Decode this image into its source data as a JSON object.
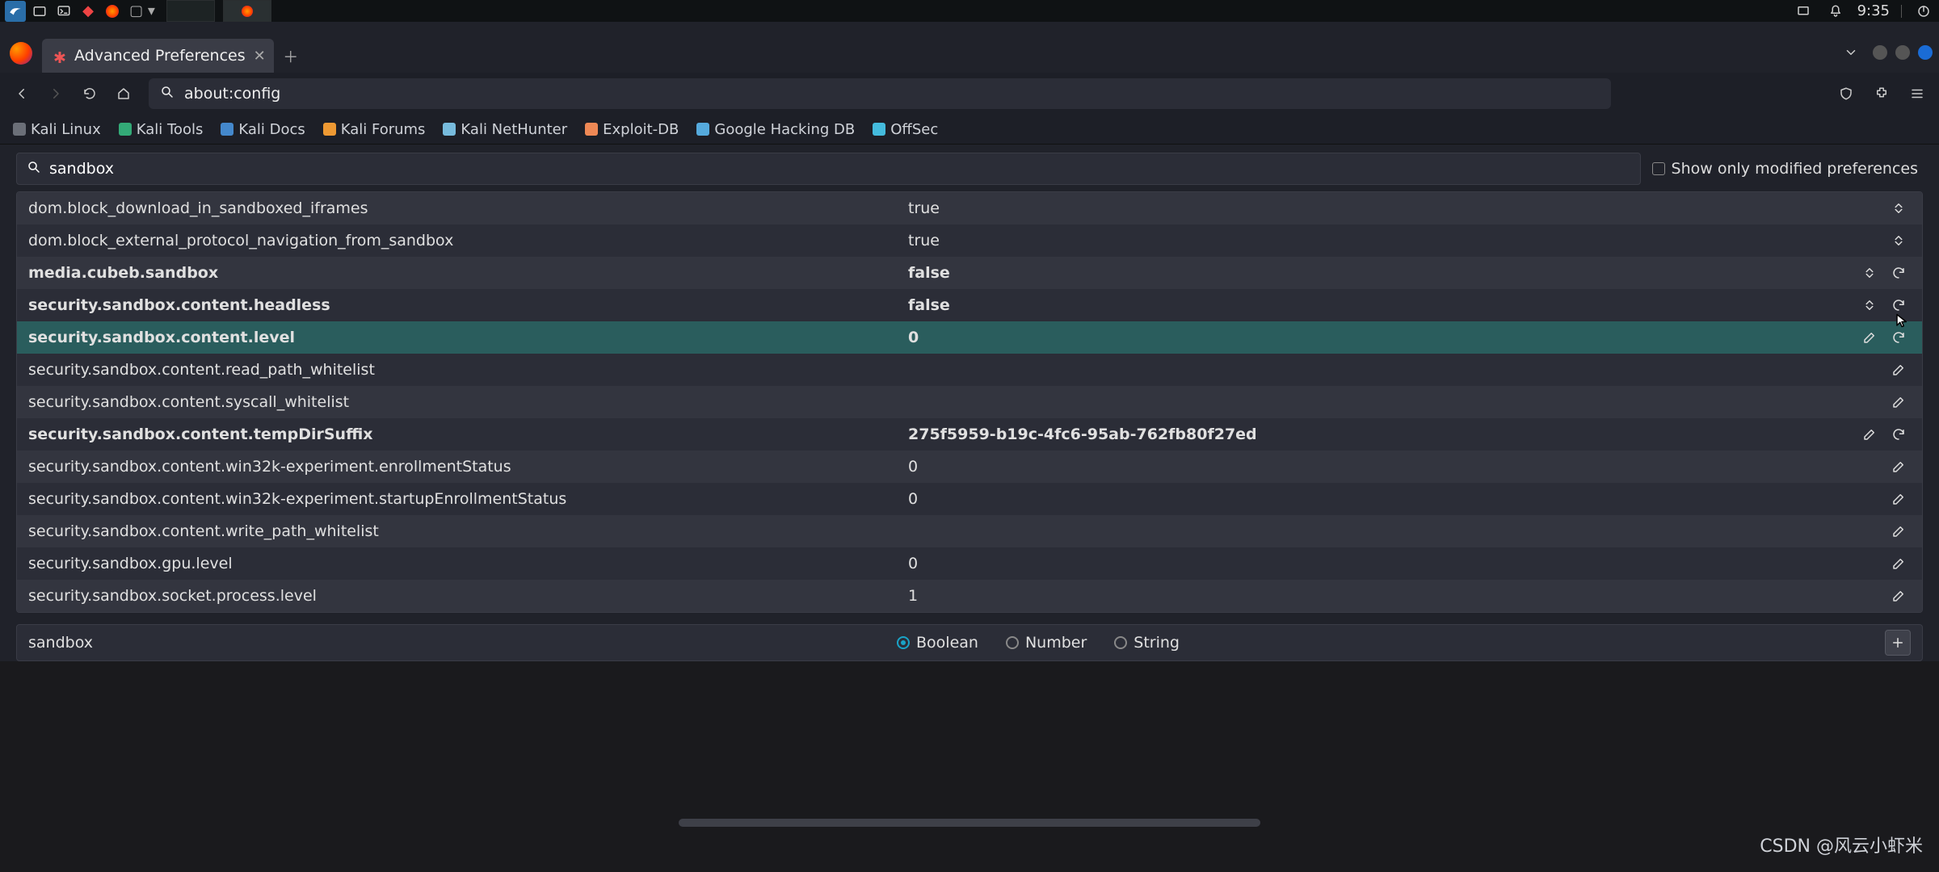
{
  "panel": {
    "clock": "9:35"
  },
  "browser": {
    "tab_title": "Advanced Preferences",
    "url": "about:config"
  },
  "bookmarks": [
    "Kali Linux",
    "Kali Tools",
    "Kali Docs",
    "Kali Forums",
    "Kali NetHunter",
    "Exploit-DB",
    "Google Hacking DB",
    "OffSec"
  ],
  "config": {
    "search_value": "sandbox",
    "show_only_modified_label": "Show only modified preferences",
    "show_only_modified_checked": false,
    "prefs": [
      {
        "name": "dom.block_download_in_sandboxed_iframes",
        "value": "true",
        "modified": false,
        "actions": [
          "toggle"
        ]
      },
      {
        "name": "dom.block_external_protocol_navigation_from_sandbox",
        "value": "true",
        "modified": false,
        "actions": [
          "toggle"
        ]
      },
      {
        "name": "media.cubeb.sandbox",
        "value": "false",
        "modified": true,
        "actions": [
          "toggle",
          "reset"
        ]
      },
      {
        "name": "security.sandbox.content.headless",
        "value": "false",
        "modified": true,
        "actions": [
          "toggle",
          "reset"
        ]
      },
      {
        "name": "security.sandbox.content.level",
        "value": "0",
        "modified": true,
        "selected": true,
        "actions": [
          "edit",
          "reset"
        ]
      },
      {
        "name": "security.sandbox.content.read_path_whitelist",
        "value": "",
        "modified": false,
        "actions": [
          "edit"
        ]
      },
      {
        "name": "security.sandbox.content.syscall_whitelist",
        "value": "",
        "modified": false,
        "actions": [
          "edit"
        ]
      },
      {
        "name": "security.sandbox.content.tempDirSuffix",
        "value": "275f5959-b19c-4fc6-95ab-762fb80f27ed",
        "modified": true,
        "actions": [
          "edit",
          "reset"
        ]
      },
      {
        "name": "security.sandbox.content.win32k-experiment.enrollmentStatus",
        "value": "0",
        "modified": false,
        "actions": [
          "edit"
        ]
      },
      {
        "name": "security.sandbox.content.win32k-experiment.startupEnrollmentStatus",
        "value": "0",
        "modified": false,
        "actions": [
          "edit"
        ]
      },
      {
        "name": "security.sandbox.content.write_path_whitelist",
        "value": "",
        "modified": false,
        "actions": [
          "edit"
        ]
      },
      {
        "name": "security.sandbox.gpu.level",
        "value": "0",
        "modified": false,
        "actions": [
          "edit"
        ]
      },
      {
        "name": "security.sandbox.socket.process.level",
        "value": "1",
        "modified": false,
        "actions": [
          "edit"
        ]
      }
    ],
    "new_pref_name": "sandbox",
    "type_options": [
      "Boolean",
      "Number",
      "String"
    ],
    "type_selected": "Boolean"
  },
  "watermark": "CSDN @风云小虾米"
}
